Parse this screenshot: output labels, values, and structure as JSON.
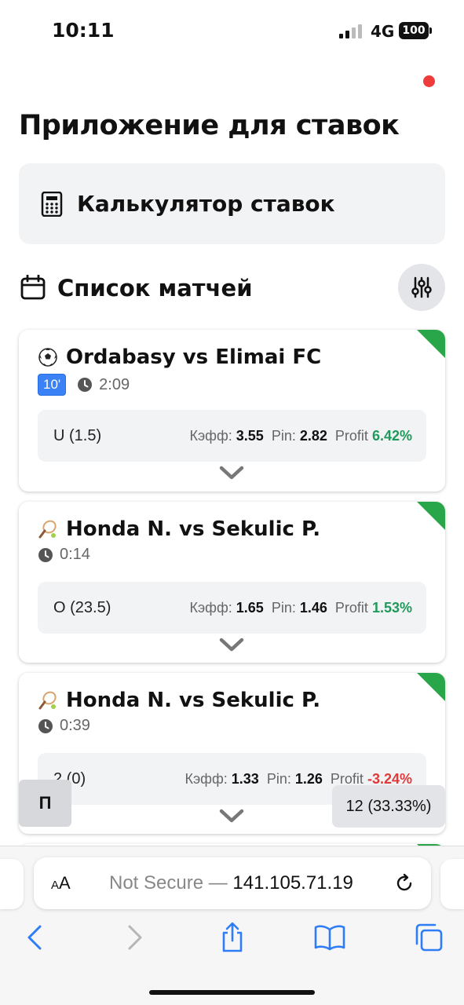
{
  "status": {
    "time": "10:11",
    "network": "4G",
    "battery": "100"
  },
  "app": {
    "title": "Приложение для ставок"
  },
  "calculator": {
    "label": "Калькулятор ставок",
    "icon": "calculator-icon"
  },
  "matches_section": {
    "title": "Список матчей",
    "icon": "calendar-icon",
    "filter_icon": "sliders-icon"
  },
  "matches": [
    {
      "sport": "football",
      "name": "Ordabasy vs Elimai FC",
      "minute": "10'",
      "time": "2:09",
      "outcome": "U (1.5)",
      "kef_label": "Кэфф:",
      "kef": "3.55",
      "pin_label": "Pin:",
      "pin": "2.82",
      "profit_label": "Profit",
      "profit": "6.42%",
      "profit_positive": true,
      "status_color": "#2aa64a"
    },
    {
      "sport": "tennis",
      "name": "Honda N. vs Sekulic P.",
      "time": "0:14",
      "outcome": "O (23.5)",
      "kef_label": "Кэфф:",
      "kef": "1.65",
      "pin_label": "Pin:",
      "pin": "1.46",
      "profit_label": "Profit",
      "profit": "1.53%",
      "profit_positive": true,
      "status_color": "#2aa64a"
    },
    {
      "sport": "tennis",
      "name": "Honda N. vs Sekulic P.",
      "time": "0:39",
      "outcome": "2 (0)",
      "kef_label": "Кэфф:",
      "kef": "1.33",
      "pin_label": "Pin:",
      "pin": "1.26",
      "profit_label": "Profit",
      "profit": "-3.24%",
      "profit_positive": false,
      "status_color": "#2aa64a"
    }
  ],
  "floating": {
    "left_label": "П",
    "right_label": "12 (33.33%)"
  },
  "browser": {
    "aa": "AA",
    "url_prefix": "Not Secure — ",
    "url_host": "141.105.71.19"
  },
  "colors": {
    "positive": "#1f9a5a",
    "negative": "#e03a3a",
    "accent": "#3b82f6",
    "browser_blue": "#2f7df6"
  }
}
